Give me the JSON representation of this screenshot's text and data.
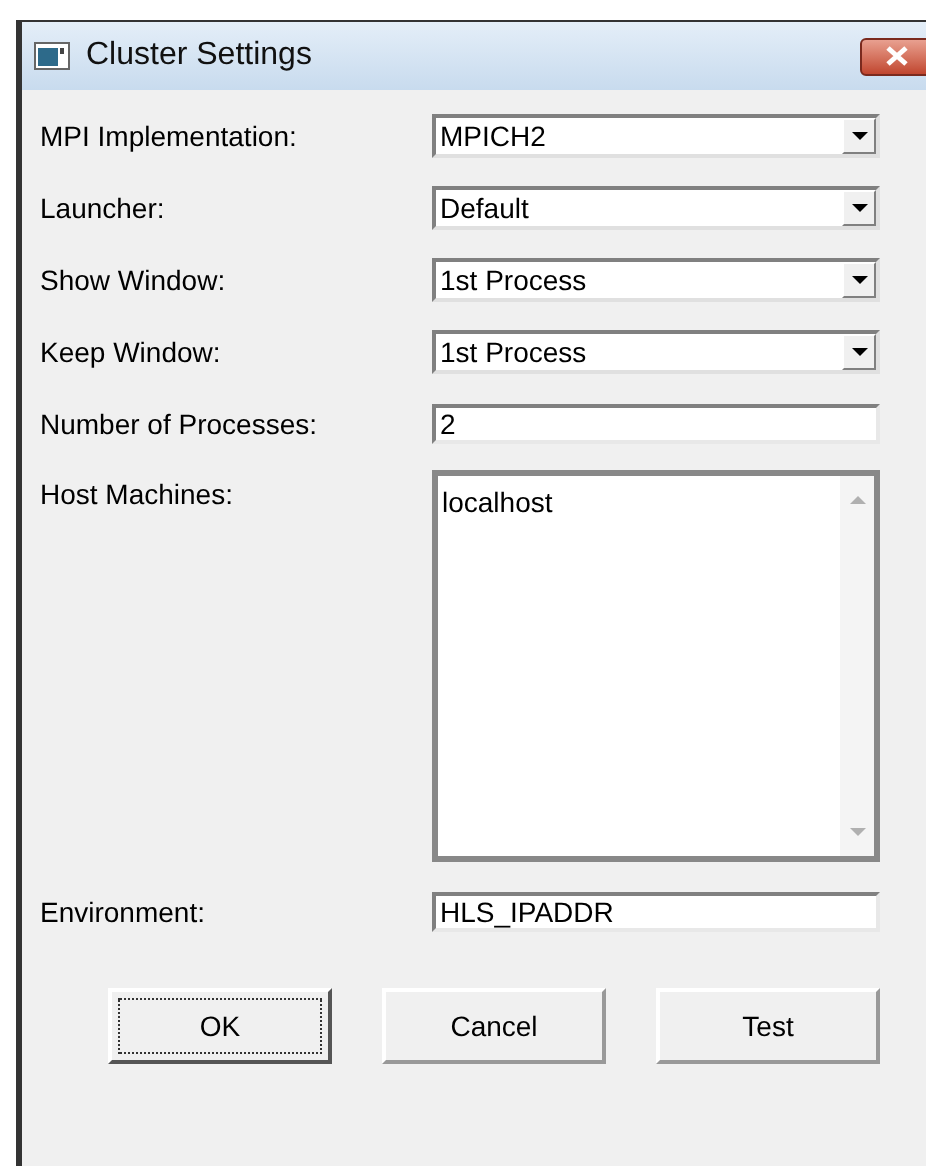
{
  "window": {
    "title": "Cluster Settings"
  },
  "fields": [
    {
      "kind": "combo",
      "label": "MPI Implementation:",
      "value": "MPICH2"
    },
    {
      "kind": "combo",
      "label": "Launcher:",
      "value": "Default"
    },
    {
      "kind": "combo",
      "label": "Show Window:",
      "value": "1st Process"
    },
    {
      "kind": "combo",
      "label": "Keep Window:",
      "value": "1st Process"
    },
    {
      "kind": "text",
      "label": "Number of Processes:",
      "value": "2"
    },
    {
      "kind": "list",
      "label": "Host Machines:",
      "items": [
        "localhost"
      ]
    },
    {
      "kind": "text",
      "label": "Environment:",
      "value": "HLS_IPADDR"
    }
  ],
  "buttons": [
    {
      "label": "OK",
      "focused": true
    },
    {
      "label": "Cancel",
      "focused": false
    },
    {
      "label": "Test",
      "focused": false
    }
  ]
}
